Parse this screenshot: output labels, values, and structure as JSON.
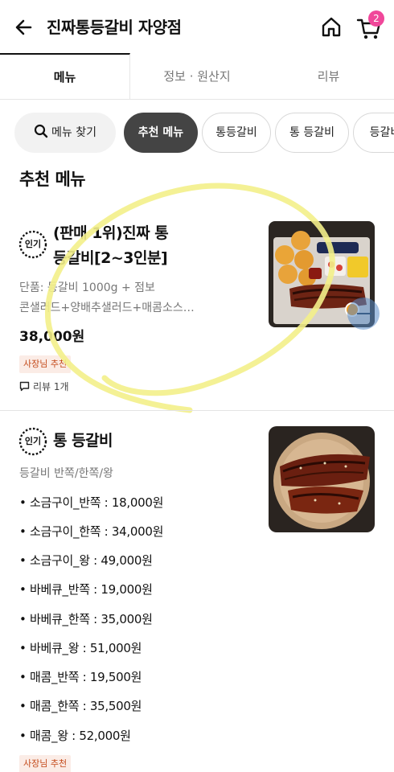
{
  "header": {
    "title": "진짜통등갈비 자양점",
    "cart_count": "2"
  },
  "tabs": [
    {
      "label": "메뉴"
    },
    {
      "label": "정보 · 원산지"
    },
    {
      "label": "리뷰"
    }
  ],
  "chips": [
    {
      "label": "메뉴 찾기"
    },
    {
      "label": "추천 메뉴"
    },
    {
      "label": "통등갈비"
    },
    {
      "label": "통 등갈비"
    },
    {
      "label": "등갈비"
    }
  ],
  "section": {
    "title": "추천 메뉴"
  },
  "items": [
    {
      "badge": "인기",
      "name_line1": "(판매 1위)진짜 통",
      "name_line2": "등갈비[2~3인분]",
      "desc_line1": "단품: 등갈비 1000g + 점보",
      "desc_line2": "콘샐러드+양배추샐러드+매콤소스…",
      "price": "38,000원",
      "tag": "사장님 추천",
      "review": "리뷰 1개"
    },
    {
      "badge": "인기",
      "name": "통 등갈비",
      "desc": "등갈비 반쪽/한쪽/왕",
      "options": [
        "• 소금구이_반쪽 : 18,000원",
        "• 소금구이_한쪽 : 34,000원",
        "• 소금구이_왕 : 49,000원",
        "• 바베큐_반쪽 : 19,000원",
        "• 바베큐_한쪽 : 35,000원",
        "• 바베큐_왕 : 51,000원",
        "• 매콤_반쪽 : 19,500원",
        "• 매콤_한쪽 : 35,500원",
        "• 매콤_왕 : 52,000원"
      ],
      "tag": "사장님 추천"
    }
  ],
  "colors": {
    "accent_pink": "#f0479a",
    "chip_active": "#444444",
    "tag_bg": "#fbece6",
    "tag_text": "#c44a1a",
    "annotation_yellow": "#f3f08a"
  },
  "icons": [
    "back-arrow-icon",
    "home-icon",
    "cart-icon",
    "search-icon",
    "popular-badge-icon",
    "comment-icon"
  ]
}
